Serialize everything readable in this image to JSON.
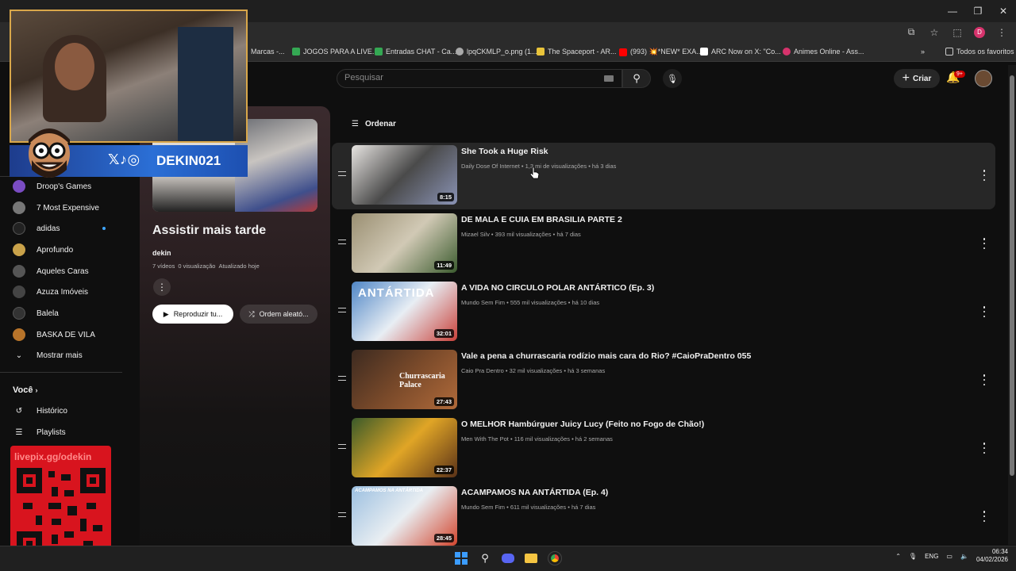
{
  "browser": {
    "window_controls": [
      "—",
      "❐",
      "✕"
    ],
    "bookmarks": [
      {
        "label": "Marcas -...",
        "color": "#888888"
      },
      {
        "label": "JOGOS PARA A LIVE...",
        "color": "#34a853"
      },
      {
        "label": "Entradas CHAT - Ca...",
        "color": "#34a853"
      },
      {
        "label": "lpqCKMLP_o.png (1...",
        "color": "#aaaaaa"
      },
      {
        "label": "The Spaceport - AR...",
        "color": "#e8c33a"
      },
      {
        "label": "(993) 💥*NEW* EXA...",
        "color": "#ff0000"
      },
      {
        "label": "ARC Now on X: \"Co...",
        "color": "#ffffff"
      },
      {
        "label": "Animes Online - Ass...",
        "color": "#d6336c"
      }
    ],
    "bookmarks_more": "»",
    "all_bookmarks": "Todos os favoritos",
    "profile_initial": "D"
  },
  "header": {
    "search_placeholder": "Pesquisar",
    "create_label": "Criar",
    "notif_badge": "9+"
  },
  "sidebar": {
    "subscriptions": [
      {
        "label": "Droop's Games",
        "color": "#7a4cc2",
        "dot": false
      },
      {
        "label": "7 Most Expensive",
        "color": "#777777",
        "dot": false
      },
      {
        "label": "adidas",
        "color": "#222222",
        "dot": true
      },
      {
        "label": "Aprofundo",
        "color": "#c9a24a",
        "dot": false
      },
      {
        "label": "Aqueles Caras",
        "color": "#555555",
        "dot": false
      },
      {
        "label": "Azuza Imóveis",
        "color": "#444444",
        "dot": false
      },
      {
        "label": "Balela",
        "color": "#333333",
        "dot": false
      },
      {
        "label": "BASKA DE VILA",
        "color": "#b8742a",
        "dot": false
      }
    ],
    "show_more": "Mostrar mais",
    "you_section": "Você",
    "history": "Histórico",
    "playlists": "Playlists"
  },
  "playlist": {
    "title": "Assistir mais tarde",
    "owner": "dekin",
    "videos_count": "7 vídeos",
    "views": "0 visualização",
    "updated": "Atualizado hoje",
    "play_all": "Reproduzir tu...",
    "shuffle": "Ordem aleató..."
  },
  "sort_label": "Ordenar",
  "videos": [
    {
      "title": "She Took a Huge Risk",
      "channel": "Daily Dose Of Internet",
      "views": "1,3 mi de visualizações",
      "age": "há 3 dias",
      "duration": "8:15",
      "thumb": [
        "#e7e4e1",
        "#4a4a4a",
        "#8a93b5"
      ]
    },
    {
      "title": "DE MALA E CUIA EM BRASILIA PARTE 2",
      "channel": "Mizael Silv",
      "views": "393 mil visualizações",
      "age": "há 7 dias",
      "duration": "11:49",
      "thumb": [
        "#9a8f72",
        "#d1c9b5",
        "#3b5b2e"
      ]
    },
    {
      "title": "A VIDA NO CIRCULO POLAR ANTÁRTICO (Ep. 3)",
      "channel": "Mundo Sem Fim",
      "views": "555 mil visualizações",
      "age": "há 10 dias",
      "duration": "32:01",
      "thumb": [
        "#4f86c6",
        "#e8eef4",
        "#c9413a"
      ]
    },
    {
      "title": "Vale a pena a churrascaria rodízio mais cara do Rio? #CaioPraDentro 055",
      "channel": "Caio Pra Dentro",
      "views": "32 mil visualizações",
      "age": "há 3 semanas",
      "duration": "27:43",
      "thumb": [
        "#3c2a20",
        "#7a4a2a",
        "#b06a3a"
      ]
    },
    {
      "title": "O MELHOR Hambúrguer Juicy Lucy (Feito no Fogo de Chão!)",
      "channel": "Men With The Pot",
      "views": "116 mil visualizações",
      "age": "há 2 semanas",
      "duration": "22:37",
      "thumb": [
        "#3a5a2a",
        "#e0a526",
        "#5a3218"
      ]
    },
    {
      "title": "ACAMPAMOS NA ANTÁRTIDA (Ep. 4)",
      "channel": "Mundo Sem Fim",
      "views": "611 mil visualizações",
      "age": "há 7 dias",
      "duration": "28:45",
      "thumb": [
        "#9bbfe0",
        "#e9eef2",
        "#d2452e"
      ]
    }
  ],
  "thumb_text": {
    "antartida": "ANTÁRTIDA",
    "churrascaria": "Churrascaria Palace",
    "acampamos": "ACAMPAMOS NA ANTÁRTIDA"
  },
  "overlay": {
    "handle": "DEKIN021",
    "livepix": "livepix.gg/odekin"
  },
  "taskbar": {
    "lang": "ENG",
    "time": "06:34",
    "date": "04/02/2026"
  }
}
